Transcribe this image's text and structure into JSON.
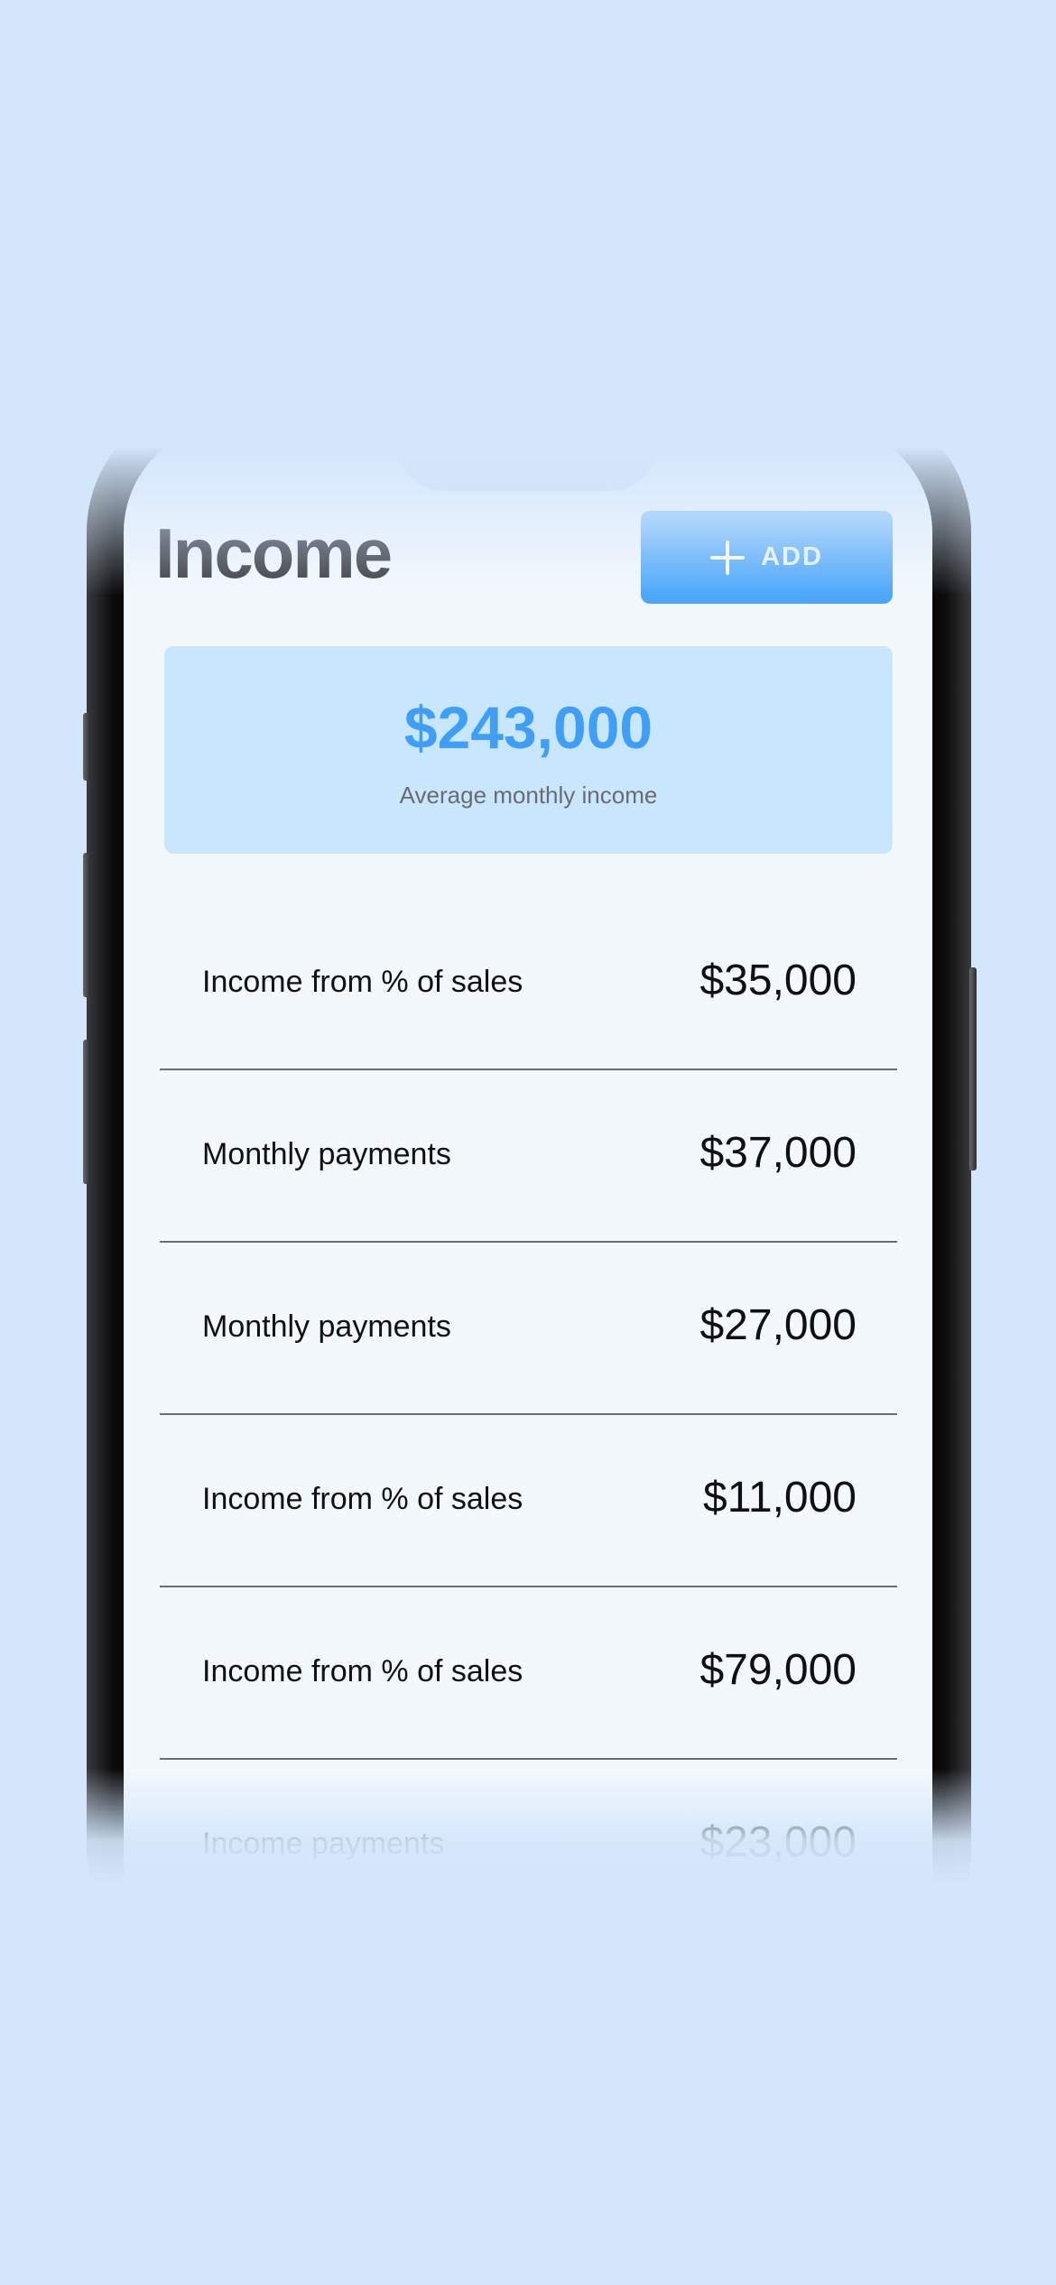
{
  "header": {
    "title": "Income",
    "add_label": "ADD"
  },
  "summary": {
    "amount": "$243,000",
    "label": "Average monthly income"
  },
  "items": [
    {
      "label": "Income from % of sales",
      "amount": "$35,000"
    },
    {
      "label": "Monthly payments",
      "amount": "$37,000"
    },
    {
      "label": "Monthly payments",
      "amount": "$27,000"
    },
    {
      "label": "Income from % of sales",
      "amount": "$11,000"
    },
    {
      "label": "Income from % of sales",
      "amount": "$79,000"
    },
    {
      "label": "Income payments",
      "amount": "$23,000"
    }
  ],
  "colors": {
    "accent": "#3f9ef7",
    "button": "#5fb0fb",
    "summary_bg": "#c8e6fd",
    "background": "#d3e6fb",
    "screen_bg": "#f3f8fd"
  },
  "icons": {
    "add": "plus-icon"
  }
}
